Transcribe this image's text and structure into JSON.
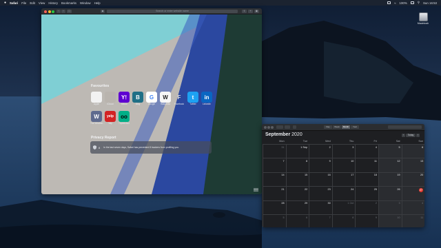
{
  "menubar": {
    "app_name": "Safari",
    "items": [
      "File",
      "Edit",
      "View",
      "History",
      "Bookmarks",
      "Window",
      "Help"
    ],
    "battery": "100%",
    "clock": "Sun 16:53"
  },
  "desktop": {
    "drive_label": "Macintosh"
  },
  "safari": {
    "url_placeholder": "Search or enter website name",
    "favourites_title": "Favourites",
    "favourites": [
      {
        "label": "Apple",
        "glyph": "",
        "bg": "#f2f2f2",
        "fg": "#333333"
      },
      {
        "label": "iCloud",
        "glyph": "",
        "bg": "#b9b4ae",
        "fg": "#7c7c7c"
      },
      {
        "label": "Yahoo",
        "glyph": "Y!",
        "bg": "#5f01d1",
        "fg": "#ffffff"
      },
      {
        "label": "Bing",
        "glyph": "B",
        "bg": "#1f6f86",
        "fg": "#ffffff"
      },
      {
        "label": "Google",
        "glyph": "G",
        "bg": "#ffffff",
        "fg": "#4285f4"
      },
      {
        "label": "Wikipedia",
        "glyph": "W",
        "bg": "#f7f7f7",
        "fg": "#222222"
      },
      {
        "label": "Facebook",
        "glyph": "F",
        "bg": "transparent",
        "fg": "#dcdcdc"
      },
      {
        "label": "Twitter",
        "glyph": "t",
        "bg": "#1da1f2",
        "fg": "#ffffff"
      },
      {
        "label": "LinkedIn",
        "glyph": "in",
        "bg": "#0a66c2",
        "fg": "#ffffff"
      },
      {
        "label": "The Weather...",
        "glyph": "W",
        "bg": "#5e6a8e",
        "fg": "#ffffff"
      },
      {
        "label": "Yelp",
        "glyph": "yelp",
        "bg": "#d32323",
        "fg": "#ffffff"
      },
      {
        "label": "TripAdvisor",
        "glyph": "oo",
        "bg": "#00af87",
        "fg": "#000000"
      }
    ],
    "privacy_title": "Privacy Report",
    "privacy_count": "8",
    "privacy_text": "In the last seven days, Safari has prevented 8 trackers from profiling you."
  },
  "calendar": {
    "views": [
      "Day",
      "Week",
      "Month",
      "Year"
    ],
    "active_view": "Month",
    "month": "September",
    "year": "2020",
    "today_label": "Today",
    "weekdays": [
      "Mon",
      "Tue",
      "Wed",
      "Thu",
      "Fri",
      "Sat",
      "Sun"
    ],
    "weeks": [
      [
        "31",
        "1 Sep",
        "2",
        "3",
        "4",
        "5",
        "6"
      ],
      [
        "7",
        "8",
        "9",
        "10",
        "11",
        "12",
        "13"
      ],
      [
        "14",
        "15",
        "16",
        "17",
        "18",
        "19",
        "20"
      ],
      [
        "21",
        "22",
        "23",
        "24",
        "25",
        "26",
        "27"
      ],
      [
        "28",
        "29",
        "30",
        "1 Oct",
        "2",
        "3",
        "4"
      ],
      [
        "5",
        "6",
        "7",
        "8",
        "9",
        "10",
        "11"
      ]
    ],
    "today_index": [
      3,
      6
    ]
  },
  "colors": {
    "accent_red": "#e63b30",
    "twitter_blue": "#1da1f2",
    "linkedin_blue": "#0a66c2"
  }
}
